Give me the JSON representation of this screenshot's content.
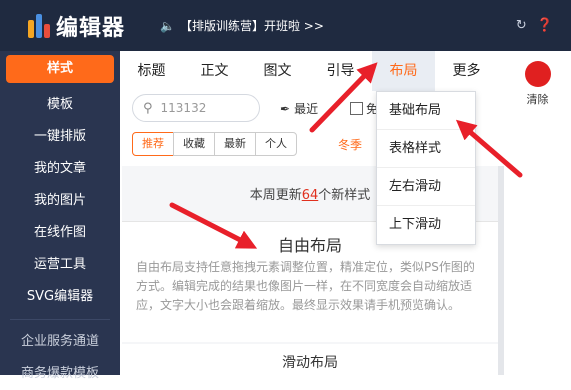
{
  "app": {
    "title": "编辑器",
    "announcement": "【排版训练营】开班啦 >>"
  },
  "sidebar": {
    "items": [
      {
        "label": "样式",
        "active": true
      },
      {
        "label": "模板"
      },
      {
        "label": "一键排版"
      },
      {
        "label": "我的文章"
      },
      {
        "label": "我的图片"
      },
      {
        "label": "在线作图"
      },
      {
        "label": "运营工具"
      },
      {
        "label": "SVG编辑器"
      }
    ],
    "bottom_items": [
      {
        "label": "企业服务通道"
      },
      {
        "label": "商务爆款模板"
      }
    ]
  },
  "tabs": [
    {
      "label": "标题"
    },
    {
      "label": "正文"
    },
    {
      "label": "图文"
    },
    {
      "label": "引导"
    },
    {
      "label": "布局",
      "active": true
    },
    {
      "label": "更多"
    }
  ],
  "clear": {
    "label": "清除",
    "color": "#e02020"
  },
  "search": {
    "value": "113132"
  },
  "recent_label": "最近",
  "free_label": "免",
  "filters": [
    "推荐",
    "收藏",
    "最新",
    "个人"
  ],
  "season_label": "冬季",
  "content": {
    "update_prefix": "本周更新",
    "update_count": "64",
    "update_suffix": "个新样式",
    "card1_title": "自由布局",
    "card1_desc": "自由布局支持任意拖拽元素调整位置，精准定位，类似PS作图的方式。编辑完成的结果也像图片一样，在不同宽度会自动缩放适应，文字大小也会跟着缩放。最终显示效果请手机预览确认。",
    "card2_title": "滑动布局"
  },
  "dropdown": {
    "items": [
      "基础布局",
      "表格样式",
      "左右滑动",
      "上下滑动"
    ]
  },
  "colors": {
    "accent": "#ff6a1a",
    "topbar": "#1f2a40",
    "sidebar": "#2a3550",
    "arrow": "#e8202a"
  }
}
